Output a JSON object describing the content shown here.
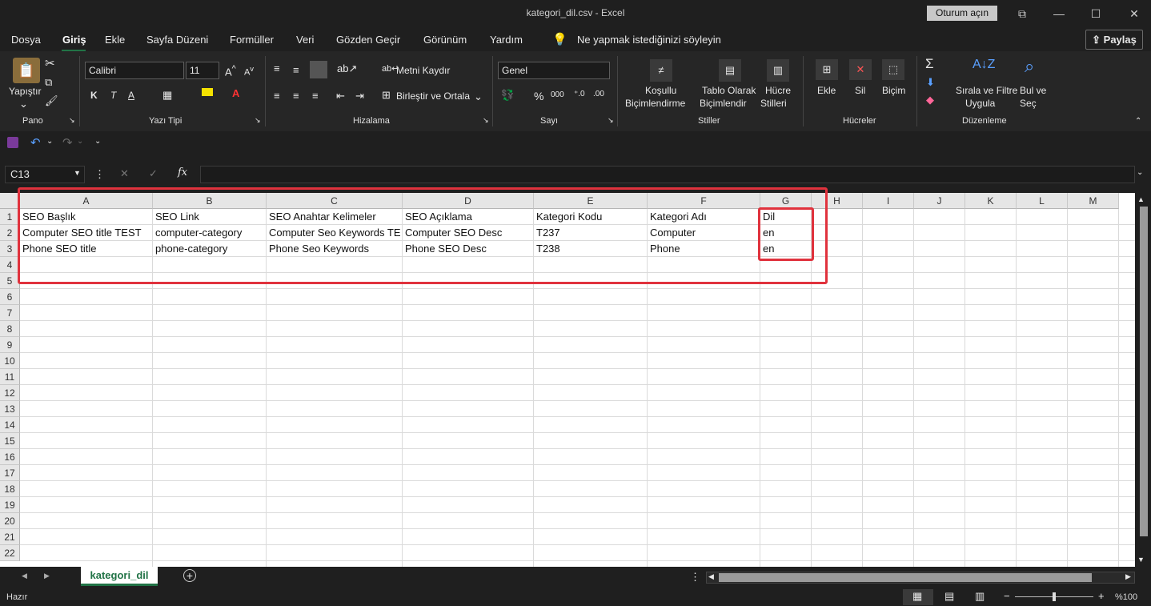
{
  "window": {
    "title": "kategori_dil.csv  -  Excel",
    "signin": "Oturum açın",
    "min": "—",
    "max": "☐",
    "close": "✕",
    "restore": "⧉"
  },
  "menu": {
    "items": [
      "Dosya",
      "Giriş",
      "Ekle",
      "Sayfa Düzeni",
      "Formüller",
      "Veri",
      "Gözden Geçir",
      "Görünüm",
      "Yardım"
    ],
    "tellme": "Ne yapmak istediğinizi söyleyin",
    "share": "Paylaş"
  },
  "ribbon": {
    "clipboard": {
      "paste": "Yapıştır",
      "group": "Pano"
    },
    "font": {
      "name": "Calibri",
      "size": "11",
      "bold": "K",
      "italic": "T",
      "underline": "A",
      "group": "Yazı Tipi"
    },
    "alignment": {
      "wrap": "Metni Kaydır",
      "merge": "Birleştir ve Ortala",
      "group": "Hizalama"
    },
    "number": {
      "format": "Genel",
      "percent": "%",
      "comma": "000",
      "group": "Sayı"
    },
    "styles": {
      "conditional1": "Koşullu",
      "conditional2": "Biçimlendirme",
      "table1": "Tablo Olarak",
      "table2": "Biçimlendir",
      "cell1": "Hücre",
      "cell2": "Stilleri",
      "group": "Stiller"
    },
    "cells": {
      "insert": "Ekle",
      "delete": "Sil",
      "format": "Biçim",
      "group": "Hücreler"
    },
    "editing": {
      "sort1": "Sırala ve Filtre",
      "sort2": "Uygula",
      "find1": "Bul ve",
      "find2": "Seç",
      "group": "Düzenleme"
    }
  },
  "formula_bar": {
    "name_box": "C13",
    "fx": "fx",
    "value": ""
  },
  "sheet": {
    "columns": [
      "A",
      "B",
      "C",
      "D",
      "E",
      "F",
      "G",
      "H",
      "I",
      "J",
      "K",
      "L",
      "M"
    ],
    "rows": [
      "1",
      "2",
      "3",
      "4",
      "5",
      "6",
      "7",
      "8",
      "9",
      "10",
      "11",
      "12",
      "13",
      "14",
      "15",
      "16",
      "17",
      "18",
      "19",
      "20",
      "21",
      "22"
    ],
    "cells": [
      [
        "SEO Başlık",
        "SEO Link",
        "SEO Anahtar Kelimeler",
        "SEO Açıklama",
        "Kategori Kodu",
        "Kategori Adı",
        "Dil"
      ],
      [
        "Computer SEO title TEST",
        "computer-category",
        "Computer Seo Keywords TE",
        "Computer SEO Desc",
        "T237",
        "Computer",
        "en"
      ],
      [
        "Phone  SEO title",
        "phone-category",
        "Phone  Seo Keywords",
        "Phone  SEO Desc",
        "T238",
        "Phone",
        "en"
      ]
    ],
    "tab": "kategori_dil",
    "highlight_color": "#e0323d"
  },
  "status": {
    "ready": "Hazır",
    "zoom": "%100"
  },
  "colors": {
    "accent": "#217346",
    "highlight": "#e0323d"
  }
}
